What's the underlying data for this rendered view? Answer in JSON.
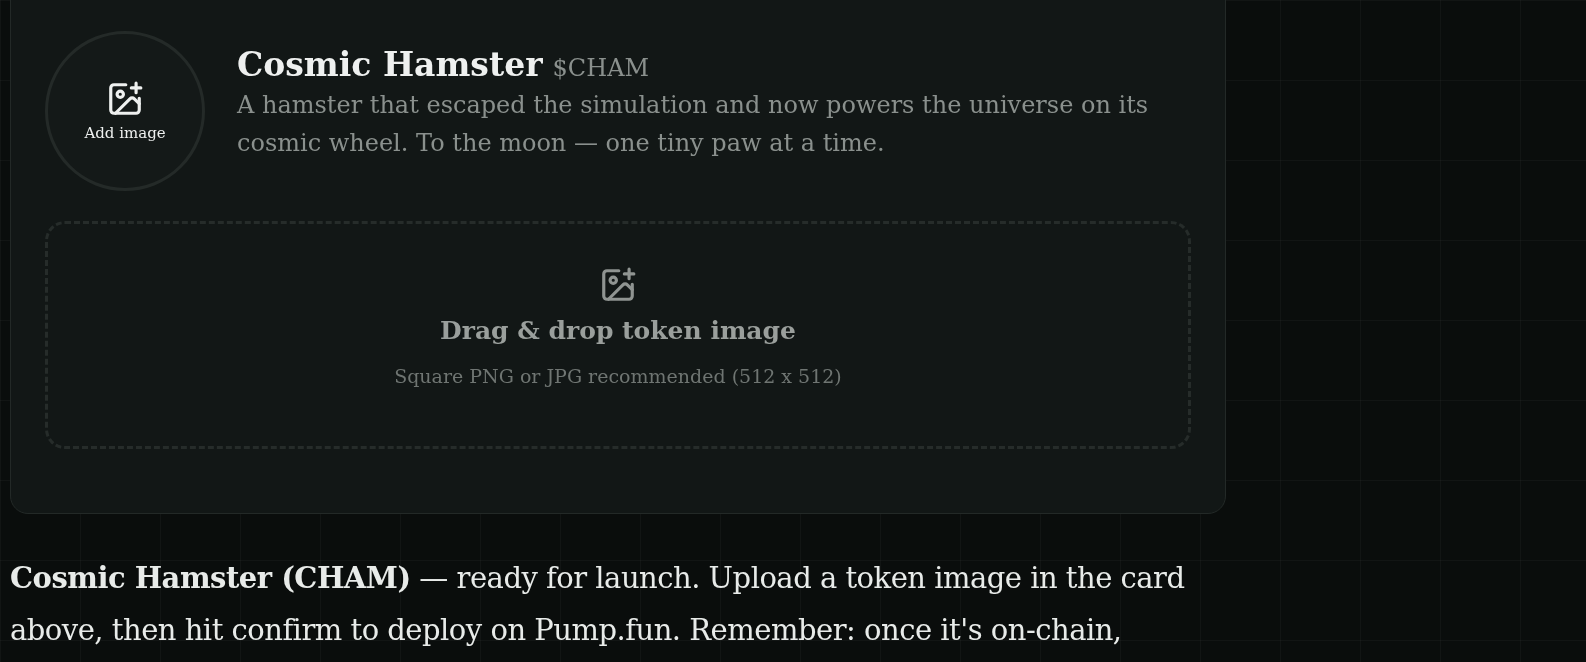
{
  "token_card": {
    "avatar": {
      "label": "Add image"
    },
    "name": "Cosmic Hamster",
    "ticker": "$CHAM",
    "description": "A hamster that escaped the simulation and now powers the universe on its cosmic wheel. To the moon — one tiny paw at a time.",
    "dropzone": {
      "title": "Drag & drop token image",
      "hint": "Square PNG or JPG recommended (512 x 512)"
    }
  },
  "message": "**Cosmic Hamster (CHAM)** — ready for launch. Upload a token image in the card above, then hit confirm to deploy on Pump.fun. Remember: once it's on-chain,"
}
